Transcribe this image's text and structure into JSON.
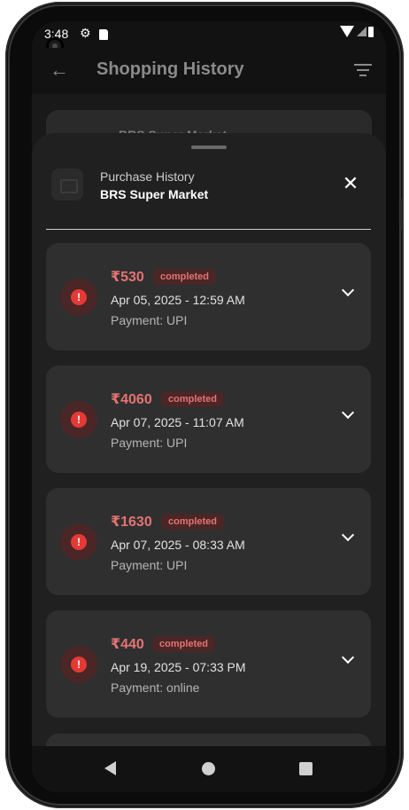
{
  "status_bar": {
    "time": "3:48",
    "icons": [
      "gear-icon",
      "sd-card-icon",
      "wifi-icon",
      "signal-icon",
      "battery-icon"
    ]
  },
  "app_bar": {
    "back_icon": "arrow-back-icon",
    "title": "Shopping History",
    "filter_icon": "filter-icon"
  },
  "background_card": {
    "text": "BRS Super Market"
  },
  "sheet": {
    "subtitle": "Purchase History",
    "title": "BRS Super Market",
    "close_icon": "close-icon",
    "store_icon": "store-icon",
    "close_symbol": "✕"
  },
  "transactions": [
    {
      "amount": "₹530",
      "status": "completed",
      "date": "Apr 05, 2025 - 12:59 AM",
      "payment": "Payment: UPI",
      "alert_symbol": "!"
    },
    {
      "amount": "₹4060",
      "status": "completed",
      "date": "Apr 07, 2025 - 11:07 AM",
      "payment": "Payment: UPI",
      "alert_symbol": "!"
    },
    {
      "amount": "₹1630",
      "status": "completed",
      "date": "Apr 07, 2025 - 08:33 AM",
      "payment": "Payment: UPI",
      "alert_symbol": "!"
    },
    {
      "amount": "₹440",
      "status": "completed",
      "date": "Apr 19, 2025 - 07:33 PM",
      "payment": "Payment: online",
      "alert_symbol": "!"
    }
  ],
  "colors": {
    "accent_red": "#e57373",
    "alert_red": "#e53935",
    "card_bg": "#2f2f2f",
    "sheet_bg": "#202020"
  },
  "navigation": {
    "back": "nav-back-icon",
    "home": "nav-home-icon",
    "recents": "nav-recents-icon"
  }
}
